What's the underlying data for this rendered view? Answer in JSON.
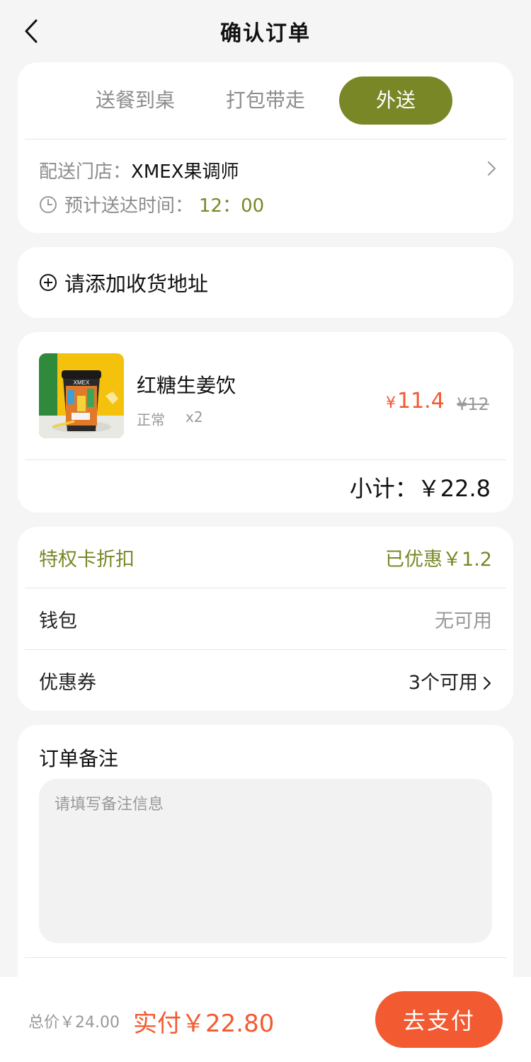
{
  "header": {
    "title": "确认订单"
  },
  "delivery": {
    "tabs": [
      {
        "label": "送餐到桌",
        "active": false
      },
      {
        "label": "打包带走",
        "active": false
      },
      {
        "label": "外送",
        "active": true
      }
    ],
    "store_label": "配送门店：",
    "store_name": "XMEX果调师",
    "time_label": "预计送达时间：",
    "time_value": "12：00"
  },
  "address": {
    "add_label": "请添加收货地址"
  },
  "product": {
    "name": "红糖生姜饮",
    "spec": "正常",
    "quantity": "x2",
    "price_symbol": "¥",
    "price": "11.4",
    "original_price": "¥12",
    "subtotal": "小计：￥22.8"
  },
  "discounts": {
    "privilege_label": "特权卡折扣",
    "privilege_value": "已优惠￥1.2",
    "wallet_label": "钱包",
    "wallet_value": "无可用",
    "coupon_label": "优惠券",
    "coupon_value": "3个可用"
  },
  "remark": {
    "title": "订单备注",
    "placeholder": "请填写备注信息"
  },
  "footer": {
    "total": "总价￥24.00",
    "actual": "实付￥22.80",
    "pay_button": "去支付"
  },
  "colors": {
    "accent": "#7a8727",
    "price": "#f25a32",
    "background": "#f5f5f5"
  }
}
